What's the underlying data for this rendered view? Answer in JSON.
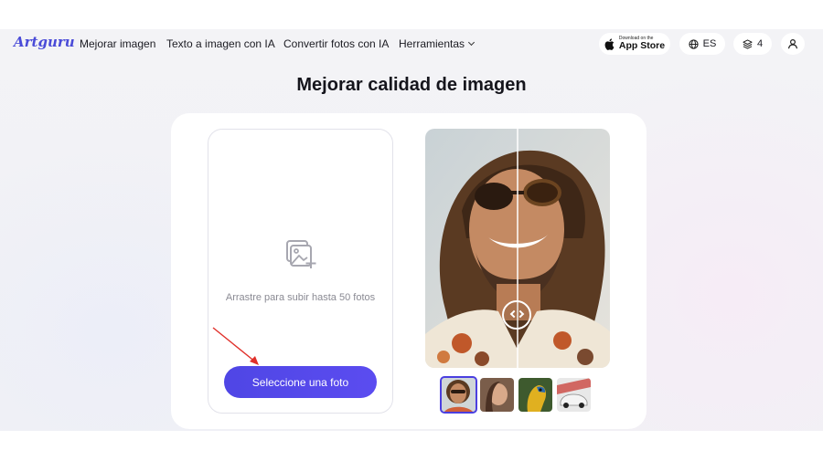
{
  "nav": {
    "logo": "Artguru",
    "links": [
      "Mejorar imagen",
      "Texto a imagen con IA",
      "Convertir fotos con IA",
      "Herramientas"
    ],
    "appstore_small": "Download on the",
    "appstore_big": "App Store",
    "language": "ES",
    "credits": "4"
  },
  "page": {
    "title": "Mejorar calidad de imagen"
  },
  "upload": {
    "hint": "Arrastre para subir hasta 50 fotos",
    "button": "Seleccione una foto"
  },
  "colors": {
    "accent": "#4f46e5",
    "arrow": "#e0302a"
  },
  "icons": [
    "apple-icon",
    "globe-icon",
    "layers-icon",
    "user-icon",
    "image-plus-icon"
  ]
}
